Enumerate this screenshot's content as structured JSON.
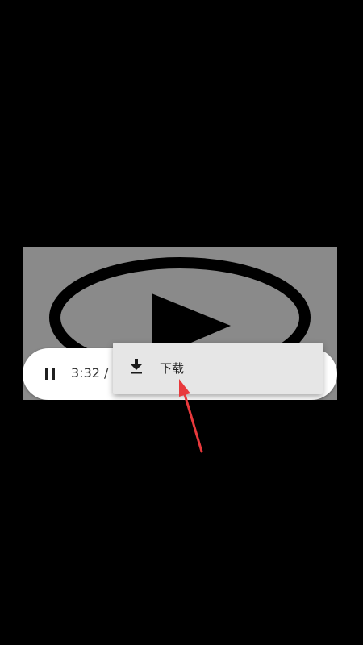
{
  "player": {
    "current_time": "3:32 /",
    "pause_icon": "pause-icon"
  },
  "menu": {
    "items": [
      {
        "label": "下载",
        "icon": "download-icon"
      }
    ]
  },
  "colors": {
    "background": "#000000",
    "thumbnail": "#8a8a8a",
    "controls_bg": "#ffffff",
    "menu_bg": "#e6e6e6",
    "annotation_arrow": "#e8393c"
  }
}
